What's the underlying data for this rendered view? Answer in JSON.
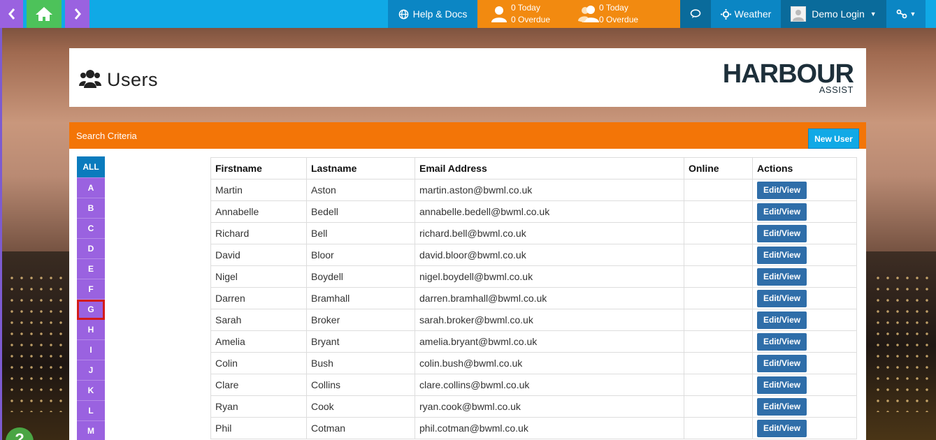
{
  "topbar": {
    "help_label": "Help & Docs",
    "tasks_self": {
      "today": "0 Today",
      "overdue": "0 Overdue"
    },
    "tasks_team": {
      "today": "0 Today",
      "overdue": "0 Overdue"
    },
    "weather_label": "Weather",
    "user_label": "Demo Login"
  },
  "header": {
    "title": "Users",
    "logo_main": "HARBOUR",
    "logo_sub": "ASSIST"
  },
  "search": {
    "title": "Search Criteria",
    "new_user_label": "New User"
  },
  "alphabet": {
    "all": "ALL",
    "letters": [
      "A",
      "B",
      "C",
      "D",
      "E",
      "F",
      "G",
      "H",
      "I",
      "J",
      "K",
      "L",
      "M"
    ],
    "highlighted": "G"
  },
  "table": {
    "headers": [
      "Firstname",
      "Lastname",
      "Email Address",
      "Online",
      "Actions"
    ],
    "action_label": "Edit/View",
    "rows": [
      {
        "first": "Martin",
        "last": "Aston",
        "email": "martin.aston@bwml.co.uk",
        "online": ""
      },
      {
        "first": "Annabelle",
        "last": "Bedell",
        "email": "annabelle.bedell@bwml.co.uk",
        "online": ""
      },
      {
        "first": "Richard",
        "last": "Bell",
        "email": "richard.bell@bwml.co.uk",
        "online": ""
      },
      {
        "first": "David",
        "last": "Bloor",
        "email": "david.bloor@bwml.co.uk",
        "online": ""
      },
      {
        "first": "Nigel",
        "last": "Boydell",
        "email": "nigel.boydell@bwml.co.uk",
        "online": ""
      },
      {
        "first": "Darren",
        "last": "Bramhall",
        "email": "darren.bramhall@bwml.co.uk",
        "online": ""
      },
      {
        "first": "Sarah",
        "last": "Broker",
        "email": "sarah.broker@bwml.co.uk",
        "online": ""
      },
      {
        "first": "Amelia",
        "last": "Bryant",
        "email": "amelia.bryant@bwml.co.uk",
        "online": ""
      },
      {
        "first": "Colin",
        "last": "Bush",
        "email": "colin.bush@bwml.co.uk",
        "online": ""
      },
      {
        "first": "Clare",
        "last": "Collins",
        "email": "clare.collins@bwml.co.uk",
        "online": ""
      },
      {
        "first": "Ryan",
        "last": "Cook",
        "email": "ryan.cook@bwml.co.uk",
        "online": ""
      },
      {
        "first": "Phil",
        "last": "Cotman",
        "email": "phil.cotman@bwml.co.uk",
        "online": ""
      }
    ]
  },
  "help_bubble": "?",
  "colors": {
    "topbar": "#10a9e6",
    "tasks": "#f28a10",
    "panel_header": "#f37507",
    "alpha_button": "#9a62e0",
    "alpha_all": "#0a7bbd",
    "edit_button": "#2f6ea9",
    "highlight": "#d31b1b"
  }
}
